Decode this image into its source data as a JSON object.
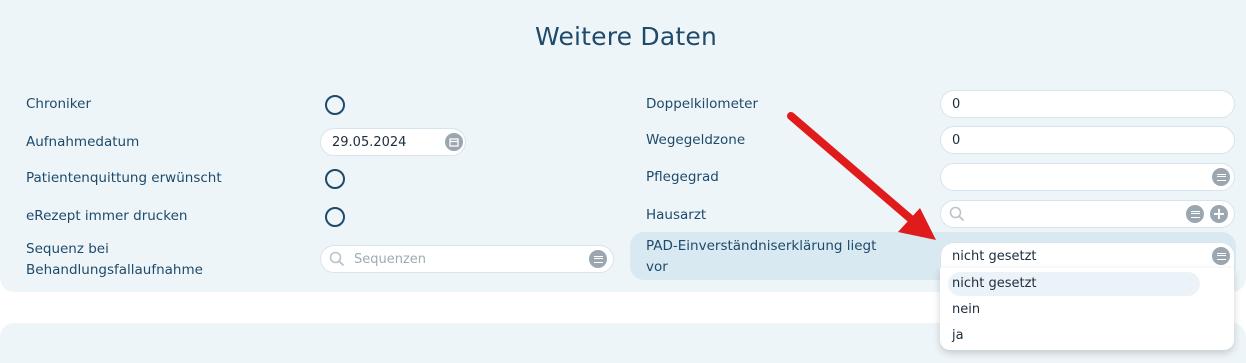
{
  "section_title": "Weitere Daten",
  "left": {
    "chroniker": "Chroniker",
    "aufnahmedatum": "Aufnahmedatum",
    "aufnahmedatum_value": "29.05.2024",
    "patientenquittung": "Patientenquittung erwünscht",
    "erezept": "eRezept immer drucken",
    "sequenz_line1": "Sequenz bei",
    "sequenz_line2": "Behandlungsfallaufnahme",
    "sequenz_placeholder": "Sequenzen"
  },
  "right": {
    "doppelkilometer": "Doppelkilometer",
    "doppelkilometer_value": "0",
    "wegegeldzone": "Wegegeldzone",
    "wegegeldzone_value": "0",
    "pflegegrad": "Pflegegrad",
    "pflegegrad_value": "",
    "hausarzt": "Hausarzt",
    "pad_line1": "PAD-Einverständniserklärung liegt",
    "pad_line2": "vor",
    "pad_value": "nicht gesetzt"
  },
  "dropdown_options": [
    "nicht gesetzt",
    "nein",
    "ja"
  ],
  "colors": {
    "text": "#1e4a6b",
    "panel": "#eef5f9",
    "arrow": "#e01b1b",
    "icon": "#9aa7b0"
  },
  "icons": [
    "calendar-icon",
    "search-icon",
    "list-icon",
    "plus-icon",
    "arrow-annotation"
  ]
}
